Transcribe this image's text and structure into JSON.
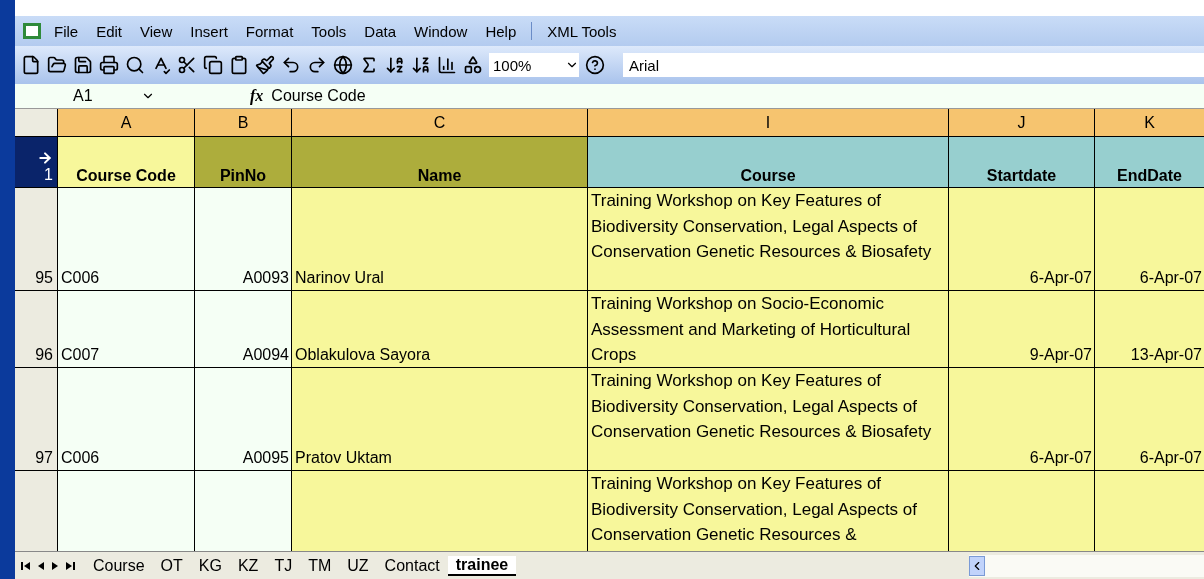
{
  "menu": [
    "File",
    "Edit",
    "View",
    "Insert",
    "Format",
    "Tools",
    "Data",
    "Window",
    "Help",
    "XML Tools"
  ],
  "toolbar": {
    "zoom": "100%",
    "font": "Arial"
  },
  "formula_bar": {
    "name_box": "A1",
    "fx": "fx",
    "value": "Course Code"
  },
  "columns": [
    "A",
    "B",
    "C",
    "I",
    "J",
    "K"
  ],
  "header_row": {
    "number": "1",
    "selected": true,
    "cells": [
      {
        "text": "Course Code",
        "color": "#f7f79b"
      },
      {
        "text": "PinNo",
        "color": "#adad3c"
      },
      {
        "text": "Name",
        "color": "#adad3c"
      },
      {
        "text": "Course",
        "color": "#97cfcf"
      },
      {
        "text": "Startdate",
        "color": "#97cfcf"
      },
      {
        "text": "EndDate",
        "color": "#97cfcf"
      }
    ]
  },
  "rows": [
    {
      "number": "95",
      "code": "C006",
      "pin": "A0093",
      "name": "Narinov  Ural",
      "course": "Training Workshop on Key Features of Biodiversity Conservation, Legal Aspects of Conservation Genetic Resources & Biosafety",
      "start": "6-Apr-07",
      "end": "6-Apr-07"
    },
    {
      "number": "96",
      "code": "C007",
      "pin": "A0094",
      "name": "Oblakulova    Sayora",
      "course": "Training Workshop on Socio-Economic Assessment and Marketing of Horticultural Crops",
      "start": "9-Apr-07",
      "end": "13-Apr-07"
    },
    {
      "number": "97",
      "code": "C006",
      "pin": "A0095",
      "name": "Pratov  Uktam",
      "course": "Training Workshop on Key Features of Biodiversity Conservation, Legal Aspects of Conservation Genetic Resources & Biosafety",
      "start": "6-Apr-07",
      "end": "6-Apr-07"
    },
    {
      "course": "Training Workshop on Key Features of Biodiversity Conservation, Legal Aspects of Conservation Genetic Resources &"
    }
  ],
  "sheet_tabs": [
    {
      "label": "Course",
      "selected": false
    },
    {
      "label": "OT",
      "selected": false
    },
    {
      "label": "KG",
      "selected": false
    },
    {
      "label": "KZ",
      "selected": false
    },
    {
      "label": "TJ",
      "selected": false
    },
    {
      "label": "TM",
      "selected": false
    },
    {
      "label": "UZ",
      "selected": false
    },
    {
      "label": "Contact",
      "selected": false
    },
    {
      "label": "trainee",
      "selected": true
    }
  ]
}
